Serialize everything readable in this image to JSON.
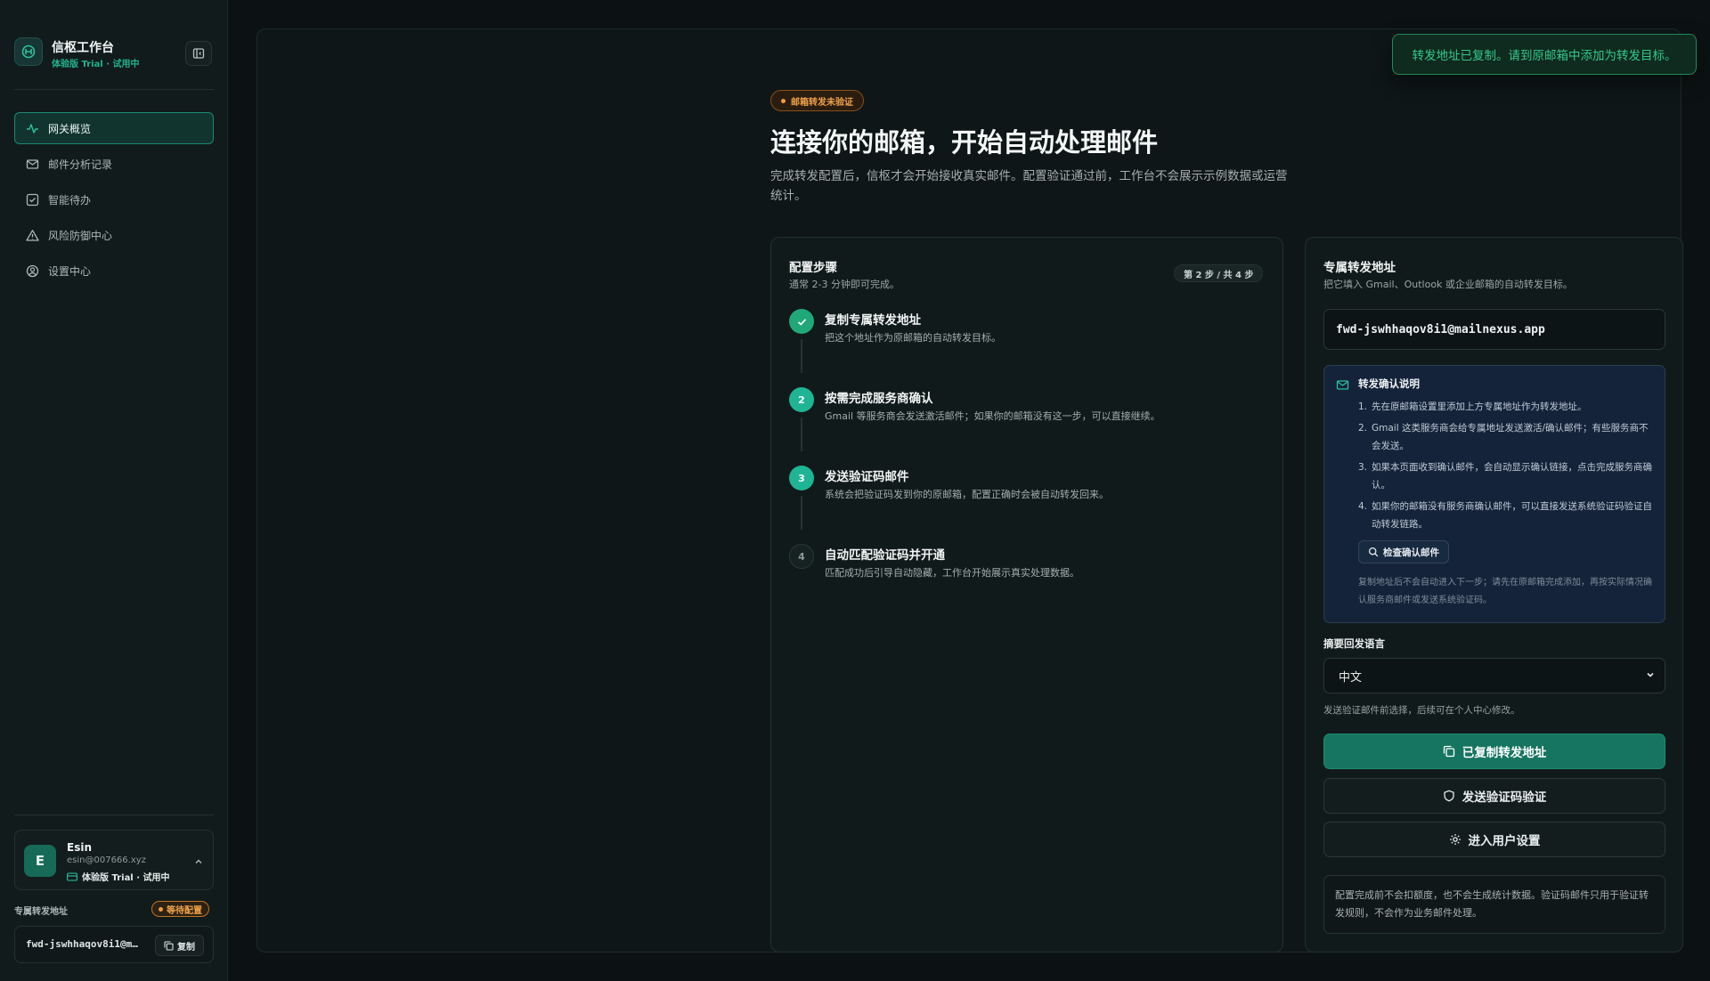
{
  "brand": {
    "title": "信枢工作台",
    "subtitle": "体验版 Trial · 试用中"
  },
  "nav": {
    "items": [
      {
        "label": "网关概览",
        "icon": "activity-icon",
        "active": true
      },
      {
        "label": "邮件分析记录",
        "icon": "mail-icon",
        "active": false
      },
      {
        "label": "智能待办",
        "icon": "checkbox-icon",
        "active": false
      },
      {
        "label": "风险防御中心",
        "icon": "alert-triangle-icon",
        "active": false
      },
      {
        "label": "设置中心",
        "icon": "user-circle-icon",
        "active": false
      }
    ]
  },
  "user": {
    "initial": "E",
    "name": "Esin",
    "email": "esin@007666.xyz",
    "plan": "体验版 Trial · 试用中"
  },
  "sidebar_forward": {
    "label": "专属转发地址",
    "status": "等待配置",
    "address": "fwd-jswhhaqov8i1@mailnexus.app",
    "copy_label": "复制"
  },
  "hero": {
    "badge": "邮箱转发未验证",
    "title": "连接你的邮箱，开始自动处理邮件",
    "description": "完成转发配置后，信枢才会开始接收真实邮件。配置验证通过前，工作台不会展示示例数据或运营统计。"
  },
  "steps_card": {
    "title": "配置步骤",
    "subtitle": "通常 2-3 分钟即可完成。",
    "progress": "第 2 步 / 共 4 步",
    "steps": [
      {
        "index": "1",
        "status": "done",
        "title": "复制专属转发地址",
        "desc": "把这个地址作为原邮箱的自动转发目标。"
      },
      {
        "index": "2",
        "status": "active",
        "title": "按需完成服务商确认",
        "desc": "Gmail 等服务商会发送激活邮件；如果你的邮箱没有这一步，可以直接继续。"
      },
      {
        "index": "3",
        "status": "active",
        "title": "发送验证码邮件",
        "desc": "系统会把验证码发到你的原邮箱，配置正确时会被自动转发回来。"
      },
      {
        "index": "4",
        "status": "pending",
        "title": "自动匹配验证码并开通",
        "desc": "匹配成功后引导自动隐藏，工作台开始展示真实处理数据。"
      }
    ]
  },
  "address_card": {
    "title": "专属转发地址",
    "subtitle": "把它填入 Gmail、Outlook 或企业邮箱的自动转发目标。",
    "address": "fwd-jswhhaqov8i1@mailnexus.app",
    "note": {
      "title": "转发确认说明",
      "items": [
        "先在原邮箱设置里添加上方专属地址作为转发地址。",
        "Gmail 这类服务商会给专属地址发送激活/确认邮件；有些服务商不会发送。",
        "如果本页面收到确认邮件，会自动显示确认链接，点击完成服务商确认。",
        "如果你的邮箱没有服务商确认邮件，可以直接发送系统验证码验证自动转发链路。"
      ],
      "check_button": "检查确认邮件",
      "footer": "复制地址后不会自动进入下一步；请先在原邮箱完成添加，再按实际情况确认服务商邮件或发送系统验证码。"
    },
    "language": {
      "label": "摘要回发语言",
      "value": "中文",
      "hint": "发送验证邮件前选择，后续可在个人中心修改。"
    },
    "buttons": {
      "copied": "已复制转发地址",
      "send_verify": "发送验证码验证",
      "user_settings": "进入用户设置"
    },
    "info": "配置完成前不会扣额度，也不会生成统计数据。验证码邮件只用于验证转发规则，不会作为业务邮件处理。"
  },
  "toast": {
    "message": "转发地址已复制。请到原邮箱中添加为转发目标。"
  },
  "colors": {
    "accent": "#167560",
    "accent_bright": "#1fb594",
    "warning": "#f0a24a",
    "background": "#0c1213"
  }
}
